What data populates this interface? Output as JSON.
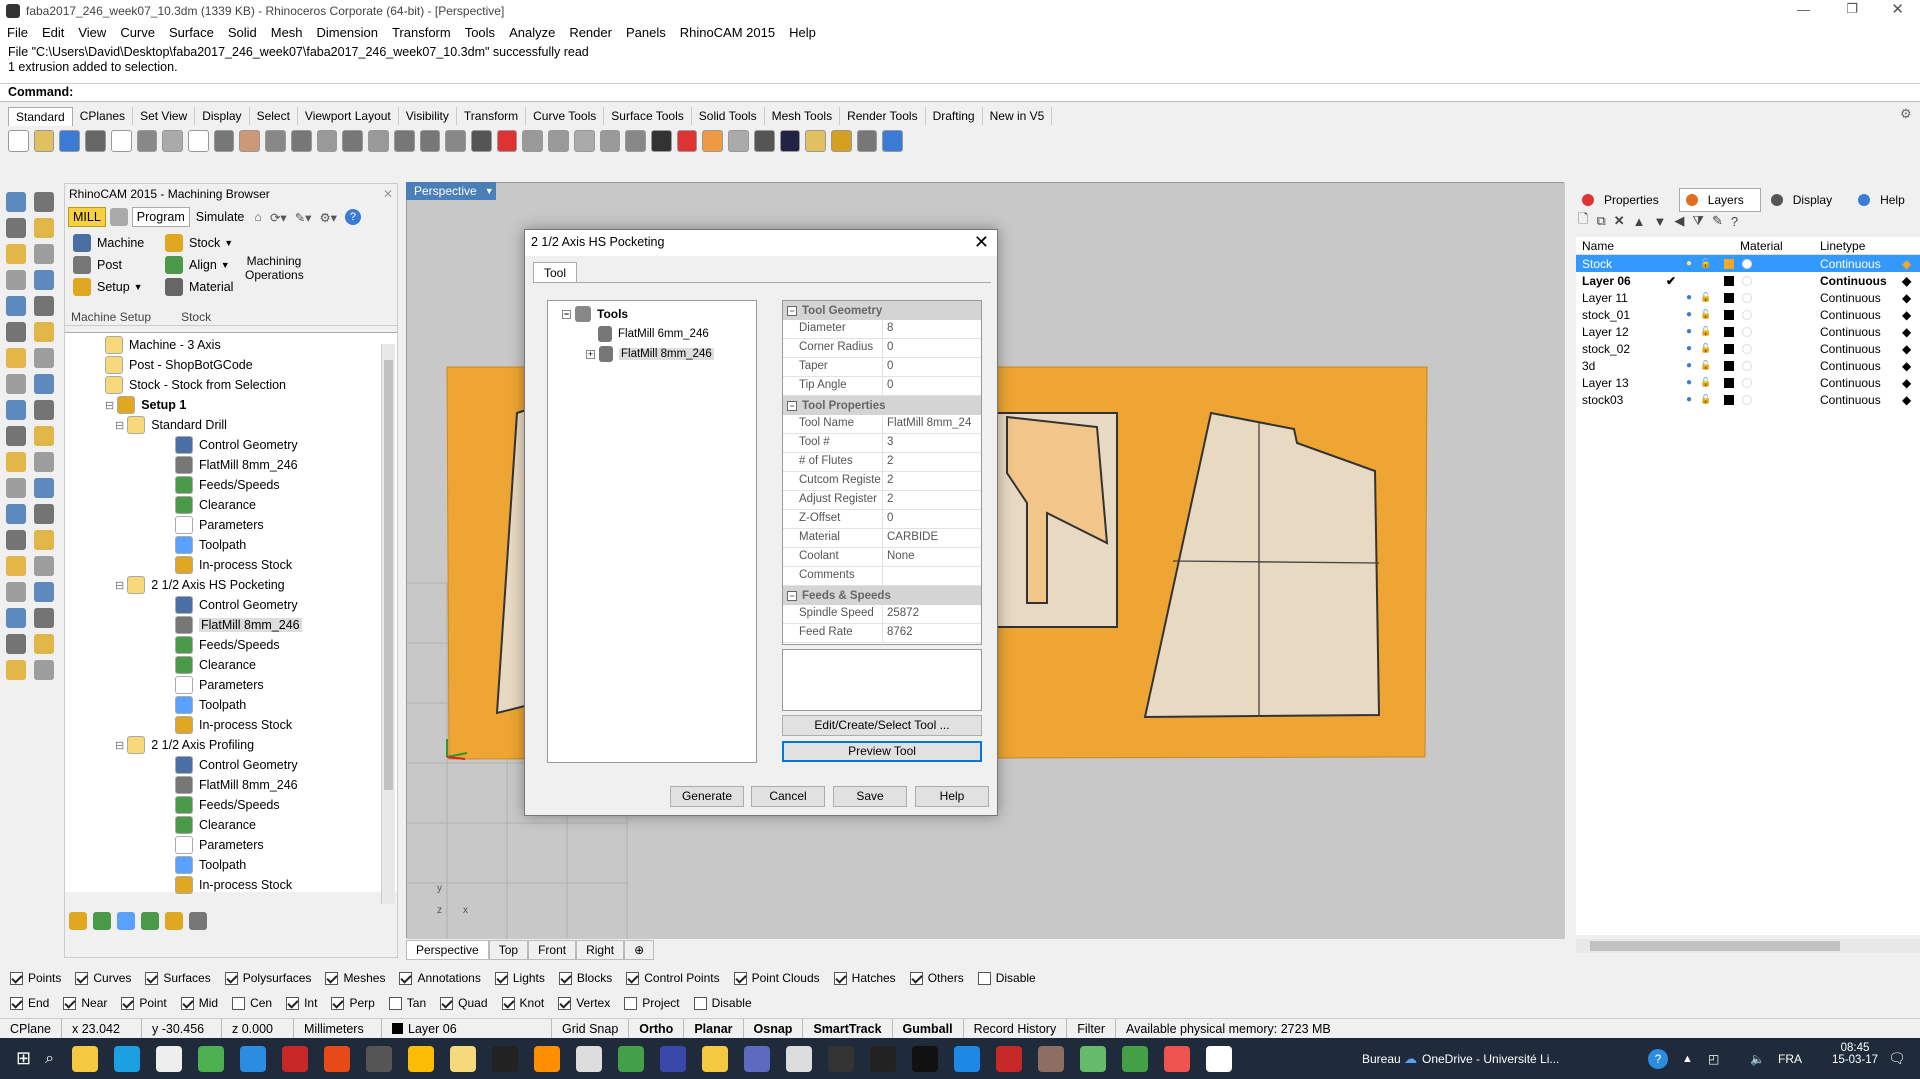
{
  "window": {
    "title": "faba2017_246_week07_10.3dm (1339 KB) - Rhinoceros Corporate (64-bit) - [Perspective]"
  },
  "menu": [
    "File",
    "Edit",
    "View",
    "Curve",
    "Surface",
    "Solid",
    "Mesh",
    "Dimension",
    "Transform",
    "Tools",
    "Analyze",
    "Render",
    "Panels",
    "RhinoCAM 2015",
    "Help"
  ],
  "command": {
    "history_line1": "File \"C:\\Users\\David\\Desktop\\faba2017_246_week07\\faba2017_246_week07_10.3dm\" successfully read",
    "history_line2": "1 extrusion added to selection.",
    "prompt": "Command:"
  },
  "toolbar_tabs": [
    "Standard",
    "CPlanes",
    "Set View",
    "Display",
    "Select",
    "Viewport Layout",
    "Visibility",
    "Transform",
    "Curve Tools",
    "Surface Tools",
    "Solid Tools",
    "Mesh Tools",
    "Render Tools",
    "Drafting",
    "New in V5"
  ],
  "browser": {
    "title": "RhinoCAM 2015 - Machining Browser",
    "tabs": {
      "mill": "MILL",
      "program": "Program",
      "simulate": "Simulate"
    },
    "buttons": {
      "machine": "Machine",
      "post": "Post",
      "setup": "Setup",
      "stock": "Stock",
      "align": "Align",
      "material": "Material",
      "machining_ops_1": "Machining",
      "machining_ops_2": "Operations"
    },
    "groups": {
      "machine_setup": "Machine Setup",
      "stock": "Stock"
    },
    "tree": [
      {
        "label": "Machine - 3 Axis",
        "level": 2
      },
      {
        "label": "Post - ShopBotGCode",
        "level": 2
      },
      {
        "label": "Stock - Stock from Selection",
        "level": 2
      },
      {
        "label": "Setup 1",
        "level": 1,
        "bold": true
      },
      {
        "label": "Standard Drill",
        "level": 2
      },
      {
        "label": "Control Geometry",
        "level": 3
      },
      {
        "label": "FlatMill 8mm_246",
        "level": 3
      },
      {
        "label": "Feeds/Speeds",
        "level": 3
      },
      {
        "label": "Clearance",
        "level": 3
      },
      {
        "label": "Parameters",
        "level": 3
      },
      {
        "label": "Toolpath",
        "level": 3
      },
      {
        "label": "In-process Stock",
        "level": 3
      },
      {
        "label": "2 1/2 Axis HS Pocketing",
        "level": 2
      },
      {
        "label": "Control Geometry",
        "level": 3
      },
      {
        "label": "FlatMill 8mm_246",
        "level": 3,
        "selected": true
      },
      {
        "label": "Feeds/Speeds",
        "level": 3
      },
      {
        "label": "Clearance",
        "level": 3
      },
      {
        "label": "Parameters",
        "level": 3
      },
      {
        "label": "Toolpath",
        "level": 3
      },
      {
        "label": "In-process Stock",
        "level": 3
      },
      {
        "label": "2 1/2 Axis Profiling",
        "level": 2
      },
      {
        "label": "Control Geometry",
        "level": 3
      },
      {
        "label": "FlatMill 8mm_246",
        "level": 3
      },
      {
        "label": "Feeds/Speeds",
        "level": 3
      },
      {
        "label": "Clearance",
        "level": 3
      },
      {
        "label": "Parameters",
        "level": 3
      },
      {
        "label": "Toolpath",
        "level": 3
      },
      {
        "label": "In-process Stock",
        "level": 3
      }
    ]
  },
  "viewport": {
    "active_label": "Perspective",
    "tabs": [
      "Perspective",
      "Top",
      "Front",
      "Right"
    ],
    "axis_y": "y",
    "axis_z": "z",
    "axis_x": "x"
  },
  "dialog": {
    "title": "2 1/2 Axis HS Pocketing",
    "tab": "Tool",
    "tree": {
      "root": "Tools",
      "items": [
        "FlatMill 6mm_246",
        "FlatMill 8mm_246"
      ]
    },
    "sections": {
      "geometry": "Tool Geometry",
      "properties": "Tool Properties",
      "feeds": "Feeds & Speeds"
    },
    "geometry": [
      {
        "k": "Diameter",
        "v": "8"
      },
      {
        "k": "Corner Radius",
        "v": "0"
      },
      {
        "k": "Taper",
        "v": "0"
      },
      {
        "k": "Tip Angle",
        "v": "0"
      }
    ],
    "properties": [
      {
        "k": "Tool Name",
        "v": "FlatMill 8mm_24"
      },
      {
        "k": "Tool #",
        "v": "3"
      },
      {
        "k": "# of Flutes",
        "v": "2"
      },
      {
        "k": "Cutcom Registe",
        "v": "2"
      },
      {
        "k": "Adjust Register",
        "v": "2"
      },
      {
        "k": "Z-Offset",
        "v": "0"
      },
      {
        "k": "Material",
        "v": "CARBIDE"
      },
      {
        "k": "Coolant",
        "v": "None"
      },
      {
        "k": "Comments",
        "v": ""
      }
    ],
    "feeds": [
      {
        "k": "Spindle Speed",
        "v": "25872"
      },
      {
        "k": "Feed Rate",
        "v": "8762"
      }
    ],
    "buttons": {
      "edit": "Edit/Create/Select Tool ...",
      "preview": "Preview Tool",
      "generate": "Generate",
      "cancel": "Cancel",
      "save": "Save",
      "help": "Help"
    }
  },
  "right_panel": {
    "tabs": [
      "Properties",
      "Layers",
      "Display",
      "Help"
    ],
    "columns": {
      "name": "Name",
      "material": "Material",
      "linetype": "Linetype"
    },
    "layers": [
      {
        "name": "Stock",
        "linetype": "Continuous",
        "color": "#f5a623",
        "selected": true
      },
      {
        "name": "Layer 06",
        "linetype": "Continuous",
        "color": "#000000",
        "current": true
      },
      {
        "name": "Layer 11",
        "linetype": "Continuous",
        "color": "#000000"
      },
      {
        "name": "stock_01",
        "linetype": "Continuous",
        "color": "#000000"
      },
      {
        "name": "Layer 12",
        "linetype": "Continuous",
        "color": "#000000"
      },
      {
        "name": "stock_02",
        "linetype": "Continuous",
        "color": "#000000"
      },
      {
        "name": "3d",
        "linetype": "Continuous",
        "color": "#000000"
      },
      {
        "name": "Layer 13",
        "linetype": "Continuous",
        "color": "#000000"
      },
      {
        "name": "stock03",
        "linetype": "Continuous",
        "color": "#000000"
      }
    ],
    "current_mark": "✔"
  },
  "filters1": [
    {
      "l": "Points",
      "on": true
    },
    {
      "l": "Curves",
      "on": true
    },
    {
      "l": "Surfaces",
      "on": true
    },
    {
      "l": "Polysurfaces",
      "on": true
    },
    {
      "l": "Meshes",
      "on": true
    },
    {
      "l": "Annotations",
      "on": true
    },
    {
      "l": "Lights",
      "on": true
    },
    {
      "l": "Blocks",
      "on": true
    },
    {
      "l": "Control Points",
      "on": true
    },
    {
      "l": "Point Clouds",
      "on": true
    },
    {
      "l": "Hatches",
      "on": true
    },
    {
      "l": "Others",
      "on": true
    },
    {
      "l": "Disable",
      "on": false
    }
  ],
  "filters2": [
    {
      "l": "End",
      "on": true
    },
    {
      "l": "Near",
      "on": true
    },
    {
      "l": "Point",
      "on": true
    },
    {
      "l": "Mid",
      "on": true
    },
    {
      "l": "Cen",
      "on": false
    },
    {
      "l": "Int",
      "on": true
    },
    {
      "l": "Perp",
      "on": true
    },
    {
      "l": "Tan",
      "on": false
    },
    {
      "l": "Quad",
      "on": true
    },
    {
      "l": "Knot",
      "on": true
    },
    {
      "l": "Vertex",
      "on": true
    },
    {
      "l": "Project",
      "on": false
    },
    {
      "l": "Disable",
      "on": false
    }
  ],
  "status": {
    "cplane": "CPlane",
    "x": "x 23.042",
    "y": "y -30.456",
    "z": "z 0.000",
    "units": "Millimeters",
    "layer": "Layer 06",
    "grid": "Grid Snap",
    "ortho": "Ortho",
    "planar": "Planar",
    "osnap": "Osnap",
    "smarttrack": "SmartTrack",
    "gumball": "Gumball",
    "history": "Record History",
    "filter": "Filter",
    "memory": "Available physical memory: 2723 MB"
  },
  "taskbar": {
    "desktop": "Bureau",
    "onedrive": "OneDrive - Université Li...",
    "lang": "FRA",
    "time": "08:45",
    "date": "15-03-17"
  },
  "colors": {
    "accent": "#4a7fb8",
    "stock": "#f0a830",
    "selection": "#3399ff"
  }
}
